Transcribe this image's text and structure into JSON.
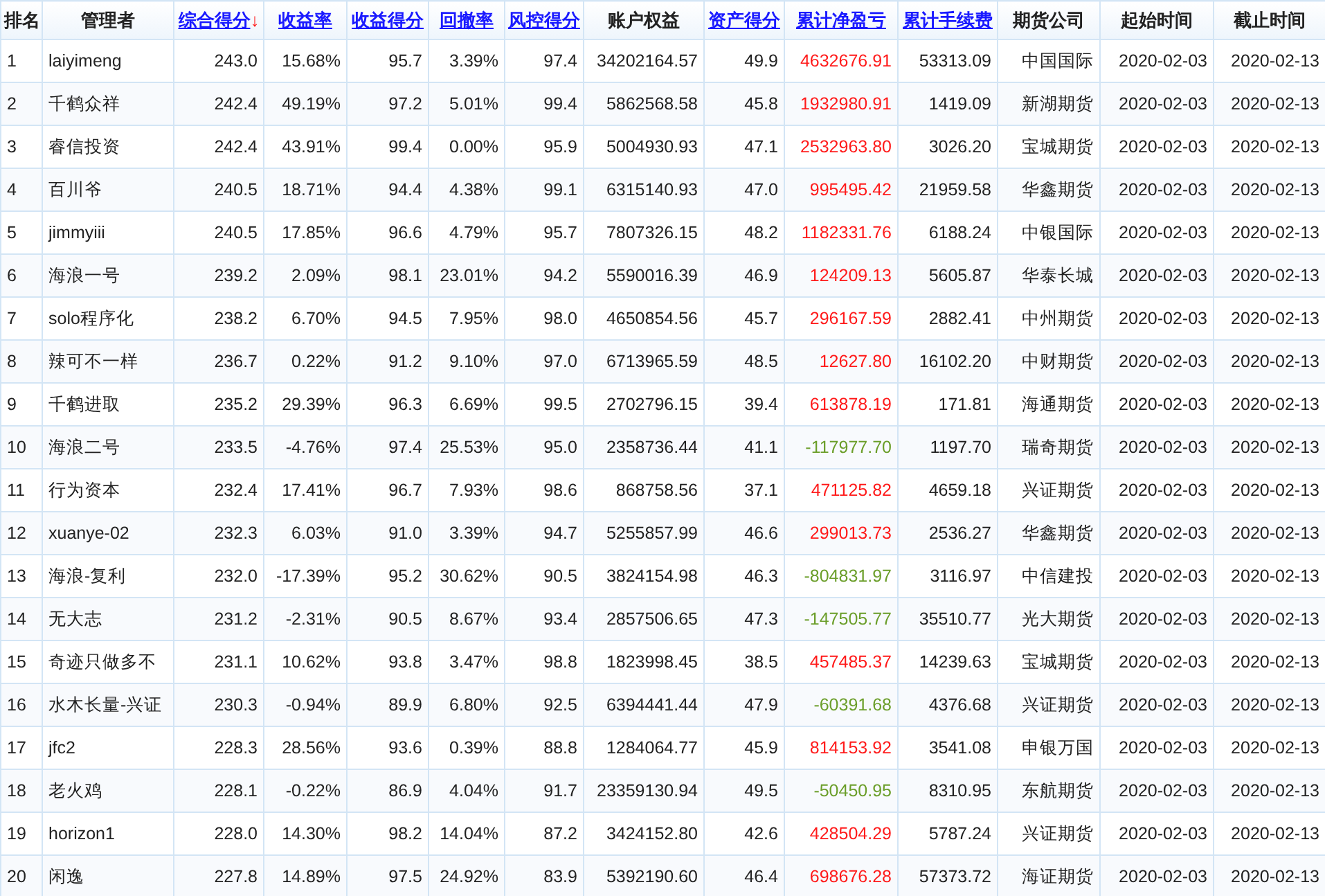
{
  "table": {
    "columns": [
      {
        "label": "排名",
        "link": false
      },
      {
        "label": "管理者",
        "link": false
      },
      {
        "label": "综合得分",
        "link": true,
        "sort_arrow": "↓"
      },
      {
        "label": "收益率",
        "link": true
      },
      {
        "label": "收益得分",
        "link": true
      },
      {
        "label": "回撤率",
        "link": true
      },
      {
        "label": "风控得分",
        "link": true
      },
      {
        "label": "账户权益",
        "link": false
      },
      {
        "label": "资产得分",
        "link": true
      },
      {
        "label": "累计净盈亏",
        "link": true
      },
      {
        "label": "累计手续费",
        "link": true
      },
      {
        "label": "期货公司",
        "link": false
      },
      {
        "label": "起始时间",
        "link": false
      },
      {
        "label": "截止时间",
        "link": false
      }
    ],
    "rows": [
      {
        "cells": [
          "1",
          "laiyimeng",
          "243.0",
          "15.68%",
          "95.7",
          "3.39%",
          "97.4",
          "34202164.57",
          "49.9",
          "4632676.91",
          "53313.09",
          "中国国际",
          "2020-02-03",
          "2020-02-13"
        ],
        "color": "#ff1a1a"
      },
      {
        "cells": [
          "2",
          "千鹤众祥",
          "242.4",
          "49.19%",
          "97.2",
          "5.01%",
          "99.4",
          "5862568.58",
          "45.8",
          "1932980.91",
          "1419.09",
          "新湖期货",
          "2020-02-03",
          "2020-02-13"
        ],
        "color": "#ff1a1a"
      },
      {
        "cells": [
          "3",
          "睿信投资",
          "242.4",
          "43.91%",
          "99.4",
          "0.00%",
          "95.9",
          "5004930.93",
          "47.1",
          "2532963.80",
          "3026.20",
          "宝城期货",
          "2020-02-03",
          "2020-02-13"
        ],
        "color": "#ff1a1a"
      },
      {
        "cells": [
          "4",
          "百川爷",
          "240.5",
          "18.71%",
          "94.4",
          "4.38%",
          "99.1",
          "6315140.93",
          "47.0",
          "995495.42",
          "21959.58",
          "华鑫期货",
          "2020-02-03",
          "2020-02-13"
        ],
        "color": "#ff1a1a"
      },
      {
        "cells": [
          "5",
          "jimmyiii",
          "240.5",
          "17.85%",
          "96.6",
          "4.79%",
          "95.7",
          "7807326.15",
          "48.2",
          "1182331.76",
          "6188.24",
          "中银国际",
          "2020-02-03",
          "2020-02-13"
        ],
        "color": "#ff1a1a"
      },
      {
        "cells": [
          "6",
          "海浪一号",
          "239.2",
          "2.09%",
          "98.1",
          "23.01%",
          "94.2",
          "5590016.39",
          "46.9",
          "124209.13",
          "5605.87",
          "华泰长城",
          "2020-02-03",
          "2020-02-13"
        ],
        "color": "#ff1a1a"
      },
      {
        "cells": [
          "7",
          "solo程序化",
          "238.2",
          "6.70%",
          "94.5",
          "7.95%",
          "98.0",
          "4650854.56",
          "45.7",
          "296167.59",
          "2882.41",
          "中州期货",
          "2020-02-03",
          "2020-02-13"
        ],
        "color": "#ff1a1a"
      },
      {
        "cells": [
          "8",
          "辣可不一样",
          "236.7",
          "0.22%",
          "91.2",
          "9.10%",
          "97.0",
          "6713965.59",
          "48.5",
          "12627.80",
          "16102.20",
          "中财期货",
          "2020-02-03",
          "2020-02-13"
        ],
        "color": "#ff1a1a"
      },
      {
        "cells": [
          "9",
          "千鹤进取",
          "235.2",
          "29.39%",
          "96.3",
          "6.69%",
          "99.5",
          "2702796.15",
          "39.4",
          "613878.19",
          "171.81",
          "海通期货",
          "2020-02-03",
          "2020-02-13"
        ],
        "color": "#ff1a1a"
      },
      {
        "cells": [
          "10",
          "海浪二号",
          "233.5",
          "-4.76%",
          "97.4",
          "25.53%",
          "95.0",
          "2358736.44",
          "41.1",
          "-117977.70",
          "1197.70",
          "瑞奇期货",
          "2020-02-03",
          "2020-02-13"
        ],
        "color": "#6b9e2a"
      },
      {
        "cells": [
          "11",
          "行为资本",
          "232.4",
          "17.41%",
          "96.7",
          "7.93%",
          "98.6",
          "868758.56",
          "37.1",
          "471125.82",
          "4659.18",
          "兴证期货",
          "2020-02-03",
          "2020-02-13"
        ],
        "color": "#ff1a1a"
      },
      {
        "cells": [
          "12",
          "xuanye-02",
          "232.3",
          "6.03%",
          "91.0",
          "3.39%",
          "94.7",
          "5255857.99",
          "46.6",
          "299013.73",
          "2536.27",
          "华鑫期货",
          "2020-02-03",
          "2020-02-13"
        ],
        "color": "#ff1a1a"
      },
      {
        "cells": [
          "13",
          "海浪-复利",
          "232.0",
          "-17.39%",
          "95.2",
          "30.62%",
          "90.5",
          "3824154.98",
          "46.3",
          "-804831.97",
          "3116.97",
          "中信建投",
          "2020-02-03",
          "2020-02-13"
        ],
        "color": "#6b9e2a"
      },
      {
        "cells": [
          "14",
          "无大志",
          "231.2",
          "-2.31%",
          "90.5",
          "8.67%",
          "93.4",
          "2857506.65",
          "47.3",
          "-147505.77",
          "35510.77",
          "光大期货",
          "2020-02-03",
          "2020-02-13"
        ],
        "color": "#6b9e2a"
      },
      {
        "cells": [
          "15",
          "奇迹只做多不",
          "231.1",
          "10.62%",
          "93.8",
          "3.47%",
          "98.8",
          "1823998.45",
          "38.5",
          "457485.37",
          "14239.63",
          "宝城期货",
          "2020-02-03",
          "2020-02-13"
        ],
        "color": "#ff1a1a"
      },
      {
        "cells": [
          "16",
          "水木长量-兴证",
          "230.3",
          "-0.94%",
          "89.9",
          "6.80%",
          "92.5",
          "6394441.44",
          "47.9",
          "-60391.68",
          "4376.68",
          "兴证期货",
          "2020-02-03",
          "2020-02-13"
        ],
        "color": "#6b9e2a"
      },
      {
        "cells": [
          "17",
          "jfc2",
          "228.3",
          "28.56%",
          "93.6",
          "0.39%",
          "88.8",
          "1284064.77",
          "45.9",
          "814153.92",
          "3541.08",
          "申银万国",
          "2020-02-03",
          "2020-02-13"
        ],
        "color": "#ff1a1a"
      },
      {
        "cells": [
          "18",
          "老火鸡",
          "228.1",
          "-0.22%",
          "86.9",
          "4.04%",
          "91.7",
          "23359130.94",
          "49.5",
          "-50450.95",
          "8310.95",
          "东航期货",
          "2020-02-03",
          "2020-02-13"
        ],
        "color": "#6b9e2a"
      },
      {
        "cells": [
          "19",
          "horizon1",
          "228.0",
          "14.30%",
          "98.2",
          "14.04%",
          "87.2",
          "3424152.80",
          "42.6",
          "428504.29",
          "5787.24",
          "兴证期货",
          "2020-02-03",
          "2020-02-13"
        ],
        "color": "#ff1a1a"
      },
      {
        "cells": [
          "20",
          "闲逸",
          "227.8",
          "14.89%",
          "97.5",
          "24.92%",
          "83.9",
          "5392190.60",
          "46.4",
          "698676.28",
          "57373.72",
          "海证期货",
          "2020-02-03",
          "2020-02-13"
        ],
        "color": "#ff1a1a"
      }
    ]
  }
}
